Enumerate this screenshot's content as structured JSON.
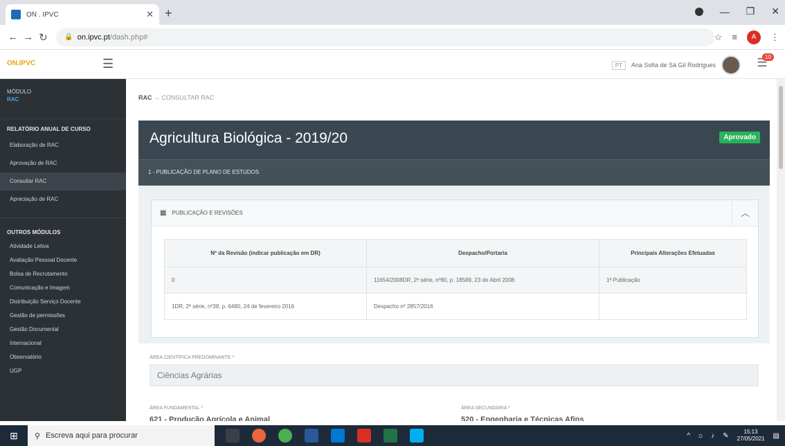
{
  "browser": {
    "tab_title": "ON . IPVC",
    "url_host": "on.ipvc.pt",
    "url_path": "/dash.php#",
    "profile_initial": "A"
  },
  "header": {
    "logo": "ON.IPVC",
    "lang": "PT",
    "user_name": "Ana Sofia de Sá Gil Rodrigues",
    "notif_count": "10"
  },
  "sidebar": {
    "module_label": "MÓDULO",
    "module_value": "RAC",
    "section1": "RELATÓRIO ANUAL DE CURSO",
    "items1": [
      "Elaboração de RAC",
      "Aprovação de RAC",
      "Consultar RAC",
      "Apreciação de RAC"
    ],
    "section2": "OUTROS MÓDULOS",
    "items2": [
      "Atividade Letiva",
      "Avaliação Pessoal Docente",
      "Bolsa de Recrutamento",
      "Comunicação e Imagem",
      "Distribuição Serviço Docente",
      "Gestão de permissões",
      "Gestão Documental",
      "Internacional",
      "Observatório",
      "UGP"
    ]
  },
  "breadcrumb": {
    "home": "RAC",
    "current": "CONSULTAR RAC"
  },
  "card": {
    "title": "Agricultura Biológica - 2019/20",
    "status": "Aprovado",
    "section": "1 - PUBLICAÇÃO DE PLANO DE ESTUDOS"
  },
  "panel": {
    "title": "PUBLICAÇÃO E REVISÕES",
    "columns": [
      "Nº da Revisão (indicar publicação em DR)",
      "Despacho/Portaria",
      "Principais Alterações Efetuadas"
    ],
    "rows": [
      [
        "0",
        "11654/2008DR, 2ª série, nº80, p. 18589, 23 de Abril 2008",
        "1ª Publicação"
      ],
      [
        "1DR, 2ª série, nº38, p. 6480, 24 de fevereiro 2016",
        "Despacho nº 2857/2016",
        ""
      ]
    ]
  },
  "fields": {
    "area_cientifica_label": "ÁREA CIENTÍFICA PREDOMINANTE *",
    "area_cientifica_value": "Ciências Agrárias",
    "area_fundamental_label": "ÁREA FUNDAMENTAL *",
    "area_fundamental_value": "621 - Produção Agrícola e Animal",
    "area_secundaria_label": "ÁREA SECUNDÁRIA *",
    "area_secundaria_value": "520 - Engenharia e Técnicas Afins"
  },
  "taskbar": {
    "search_placeholder": "Escreva aqui para procurar",
    "time": "15:13",
    "date": "27/05/2021"
  }
}
